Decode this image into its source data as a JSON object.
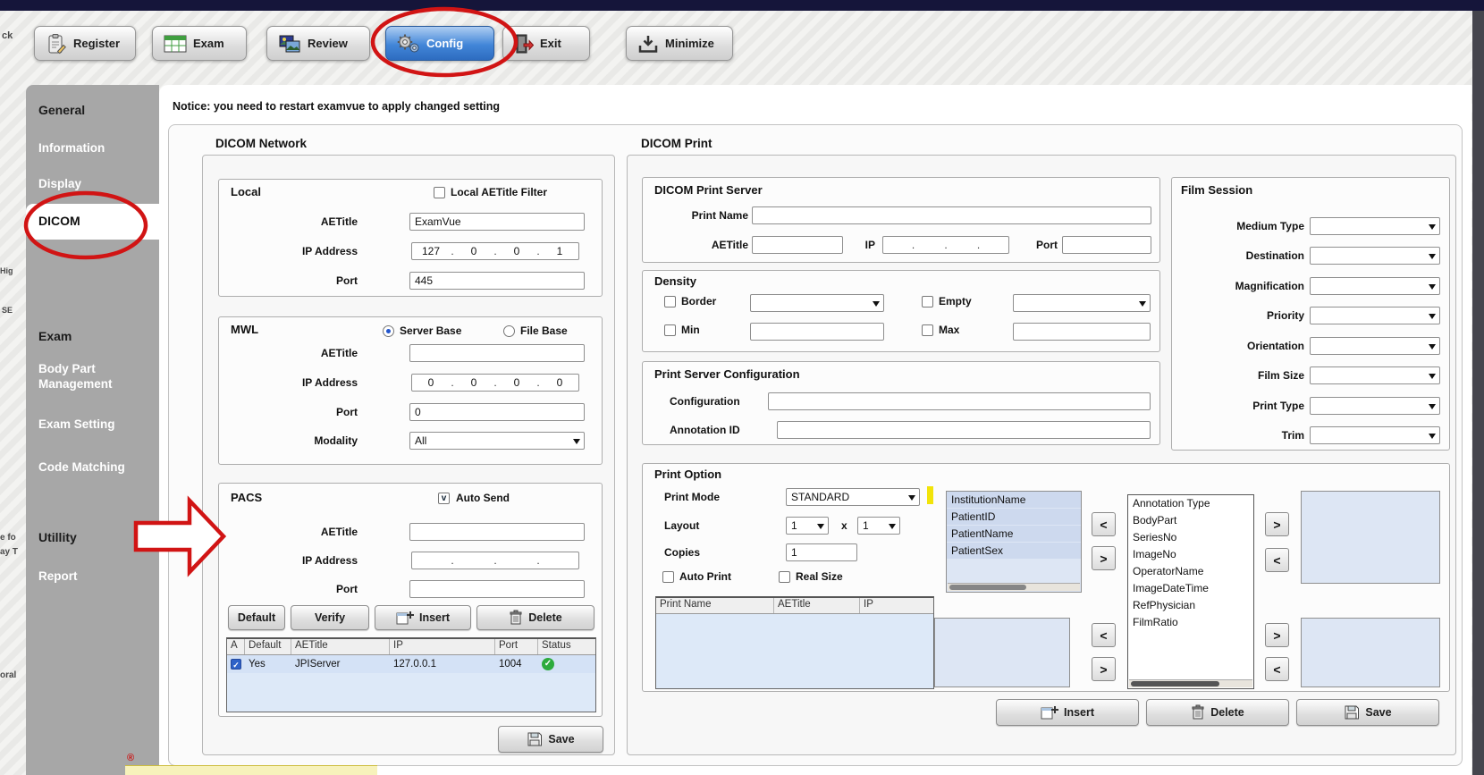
{
  "window": {
    "notice": "Notice: you need to restart examvue to apply changed setting"
  },
  "toolbar": {
    "register": "Register",
    "exam": "Exam",
    "review": "Review",
    "config": "Config",
    "exit": "Exit",
    "minimize": "Minimize"
  },
  "sidebar": {
    "general": "General",
    "information": "Information",
    "display": "Display",
    "dicom": "DICOM",
    "exam": "Exam",
    "body_part_1": "Body Part",
    "body_part_2": "Management",
    "exam_setting": "Exam Setting",
    "code_matching": "Code Matching",
    "utility": "Utillity",
    "report": "Report"
  },
  "network": {
    "title": "DICOM Network",
    "local": {
      "title": "Local",
      "filter": "Local AETitle Filter",
      "aetitle_label": "AETitle",
      "aetitle": "ExamVue",
      "ip_label": "IP Address",
      "ip": [
        "127",
        "0",
        "0",
        "1"
      ],
      "port_label": "Port",
      "port": "445"
    },
    "mwl": {
      "title": "MWL",
      "server_base": "Server Base",
      "file_base": "File Base",
      "aetitle_label": "AETitle",
      "aetitle": "",
      "ip_label": "IP Address",
      "ip": [
        "0",
        "0",
        "0",
        "0"
      ],
      "port_label": "Port",
      "port": "0",
      "modality_label": "Modality",
      "modality": "All"
    },
    "pacs": {
      "title": "PACS",
      "auto_send": "Auto Send",
      "auto_send_mark": "v",
      "aetitle_label": "AETitle",
      "aetitle": "",
      "ip_label": "IP Address",
      "ip": [
        "",
        "",
        "",
        ""
      ],
      "port_label": "Port",
      "port": "",
      "default_btn": "Default",
      "verify_btn": "Verify",
      "insert_btn": "Insert",
      "delete_btn": "Delete",
      "table": {
        "headers": [
          "A",
          "Default",
          "AETitle",
          "IP",
          "Port",
          "Status"
        ],
        "row": {
          "default": "Yes",
          "aetitle": "JPIServer",
          "ip": "127.0.0.1",
          "port": "1004",
          "status": "ok"
        }
      }
    },
    "save_btn": "Save"
  },
  "print": {
    "title": "DICOM Print",
    "server": {
      "title": "DICOM Print Server",
      "print_name_label": "Print Name",
      "print_name": "",
      "aetitle_label": "AETitle",
      "aetitle": "",
      "ip_label": "IP",
      "port_label": "Port",
      "port": ""
    },
    "density": {
      "title": "Density",
      "border": "Border",
      "empty": "Empty",
      "min": "Min",
      "max": "Max"
    },
    "psc": {
      "title": "Print Server Configuration",
      "configuration_label": "Configuration",
      "annotation_id_label": "Annotation ID"
    },
    "option": {
      "title": "Print Option",
      "print_mode_label": "Print Mode",
      "print_mode": "STANDARD",
      "layout_label": "Layout",
      "layout_rows": "1",
      "layout_x": "x",
      "layout_cols": "1",
      "copies_label": "Copies",
      "copies": "1",
      "auto_print": "Auto Print",
      "real_size": "Real Size",
      "tags": [
        "InstitutionName",
        "PatientID",
        "PatientName",
        "PatientSex"
      ],
      "annotation_header": "Annotation Type",
      "annotations": [
        "BodyPart",
        "SeriesNo",
        "ImageNo",
        "OperatorName",
        "ImageDateTime",
        "RefPhysician",
        "FilmRatio"
      ],
      "table_headers": [
        "Print Name",
        "AETitle",
        "IP"
      ]
    },
    "film": {
      "title": "Film Session",
      "labels": [
        "Medium Type",
        "Destination",
        "Magnification",
        "Priority",
        "Orientation",
        "Film Size",
        "Print Type",
        "Trim"
      ]
    },
    "insert_btn": "Insert",
    "delete_btn": "Delete",
    "save_btn": "Save"
  },
  "colors": {
    "annotation_red": "#d11414",
    "config_blue": "#4286d8",
    "status_green": "#2cab3c",
    "highlight_yellow": "#f2e40a"
  },
  "artifacts": {
    "edge_fragments": [
      "ck",
      "Hig",
      "SE",
      "e fo",
      "ay T",
      "oral"
    ],
    "reg_mark": "®"
  }
}
